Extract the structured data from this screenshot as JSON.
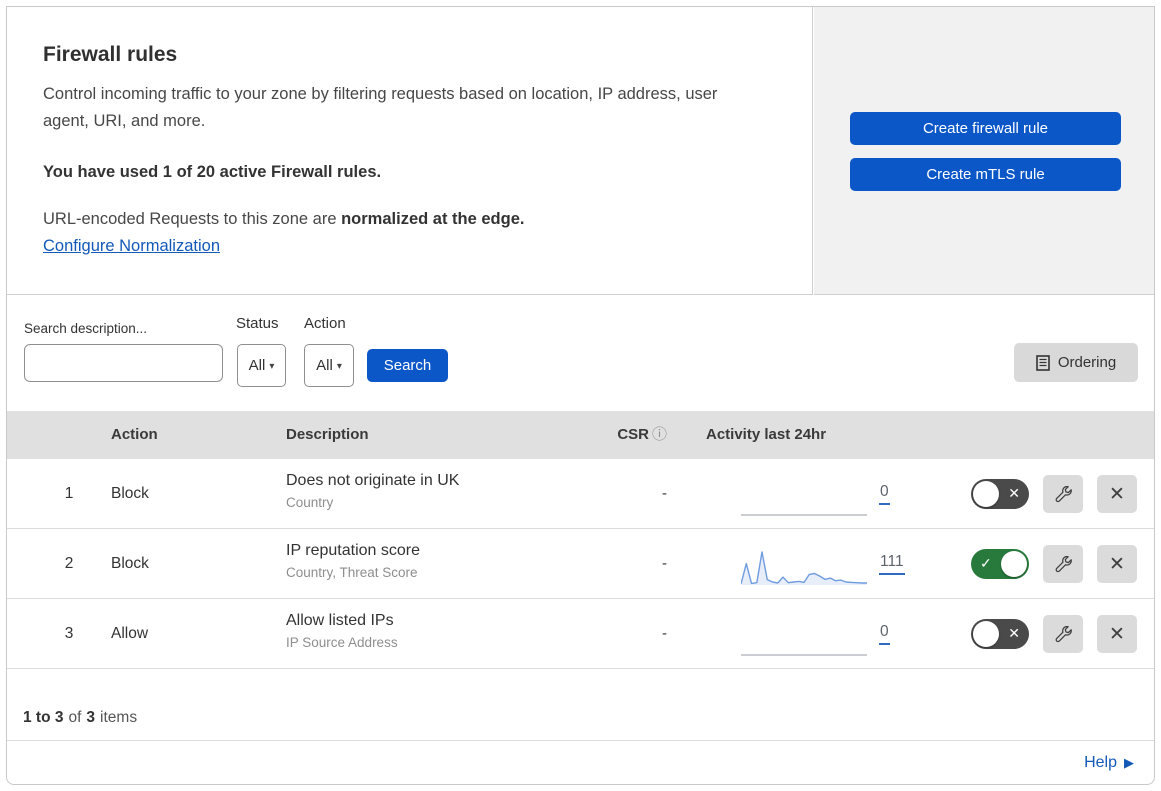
{
  "header": {
    "title": "Firewall rules",
    "description": "Control incoming traffic to your zone by filtering requests based on location, IP address, user agent, URI, and more.",
    "usage": "You have used 1 of 20 active Firewall rules.",
    "normalization_prefix": "URL-encoded Requests to this zone are ",
    "normalization_bold": "normalized at the edge.",
    "normalization_link": "Configure Normalization",
    "buttons": {
      "create_firewall": "Create firewall rule",
      "create_mtls": "Create mTLS rule"
    }
  },
  "filters": {
    "search_label": "Search description...",
    "search_value": "",
    "status_label": "Status",
    "status_value": "All",
    "action_label": "Action",
    "action_value": "All",
    "search_button": "Search",
    "ordering_button": "Ordering"
  },
  "table": {
    "columns": {
      "action": "Action",
      "description": "Description",
      "csr": "CSR",
      "activity": "Activity last 24hr"
    },
    "rows": [
      {
        "index": "1",
        "action": "Block",
        "description": "Does not originate in UK",
        "fields": "Country",
        "csr": "-",
        "state": "off",
        "activity": {
          "count": "0",
          "sparkline": []
        }
      },
      {
        "index": "2",
        "action": "Block",
        "description": "IP reputation score",
        "fields": "Country, Threat Score",
        "csr": "-",
        "state": "on",
        "activity": {
          "count": "111",
          "sparkline": [
            3,
            65,
            5,
            7,
            100,
            16,
            9,
            6,
            24,
            7,
            9,
            11,
            8,
            32,
            35,
            27,
            17,
            21,
            13,
            15,
            9,
            8,
            7,
            6,
            6
          ]
        }
      },
      {
        "index": "3",
        "action": "Allow",
        "description": "Allow listed IPs",
        "fields": "IP Source Address",
        "csr": "-",
        "state": "off",
        "activity": {
          "count": "0",
          "sparkline": []
        }
      }
    ]
  },
  "pagination": {
    "range": "1 to 3",
    "of": "of",
    "total": "3",
    "items": "items"
  },
  "footer": {
    "help": "Help"
  },
  "icons": {
    "caret": "▾",
    "info": "ⓘ",
    "check": "✓",
    "cross": "✕",
    "play": "▶"
  },
  "colors": {
    "accent_blue": "#0b57c8",
    "link_blue": "#1259b8",
    "toggle_on_green": "#287a3c",
    "toggle_off_gray": "#4a4a4a",
    "sparkline_blue": "#6f9ce0",
    "panel_gray": "#f1f1f1",
    "table_header_gray": "#e0e0e0",
    "button_gray": "#d9d9d9"
  }
}
